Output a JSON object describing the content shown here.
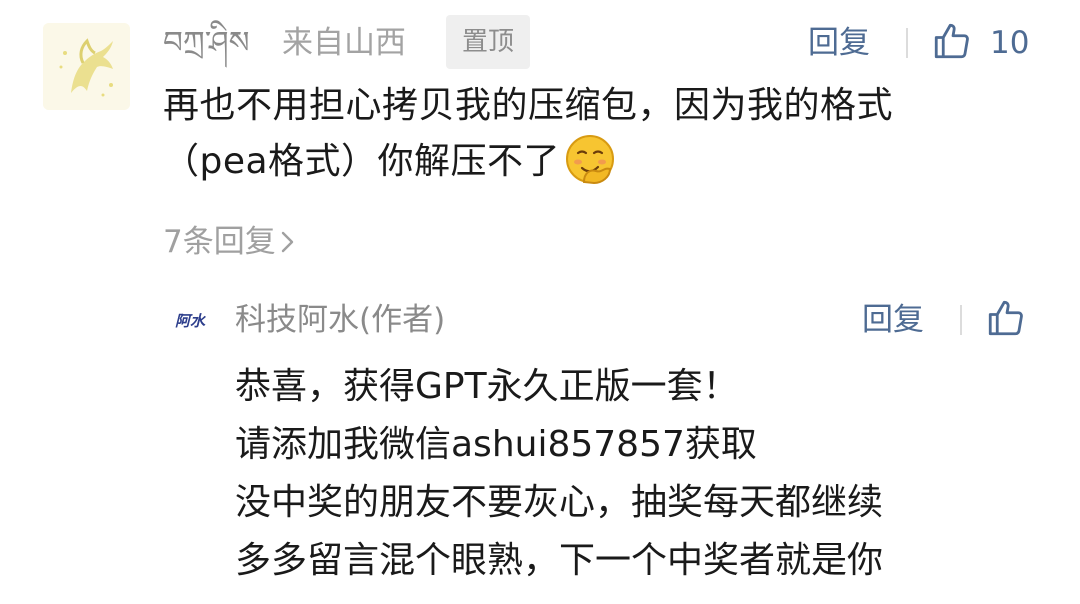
{
  "comment": {
    "username": "བཀྲ་ཤིས",
    "location": "来自山西",
    "pinned_badge": "置顶",
    "reply_label": "回复",
    "like_count": "10",
    "text_lines": [
      "再也不用担心拷贝我的压缩包，因为我的格式",
      "（pea格式）你解压不了"
    ],
    "emoji": "shy-face-emoji",
    "reply_count_label": "7条回复"
  },
  "author_reply": {
    "avatar_text": "阿水",
    "username": "科技阿水(作者)",
    "reply_label": "回复",
    "text_lines": [
      "恭喜，获得GPT永久正版一套！",
      "请添加我微信ashui857857获取",
      "没中奖的朋友不要灰心，抽奖每天都继续",
      "多多留言混个眼熟，下一个中奖者就是你"
    ]
  },
  "colors": {
    "link": "#4e6b93",
    "muted": "#8a8a8a",
    "text": "#1a1a1a",
    "badge_bg": "#efefef"
  },
  "icons": {
    "like": "thumbs-up-icon",
    "chevron": "chevron-right-icon"
  }
}
